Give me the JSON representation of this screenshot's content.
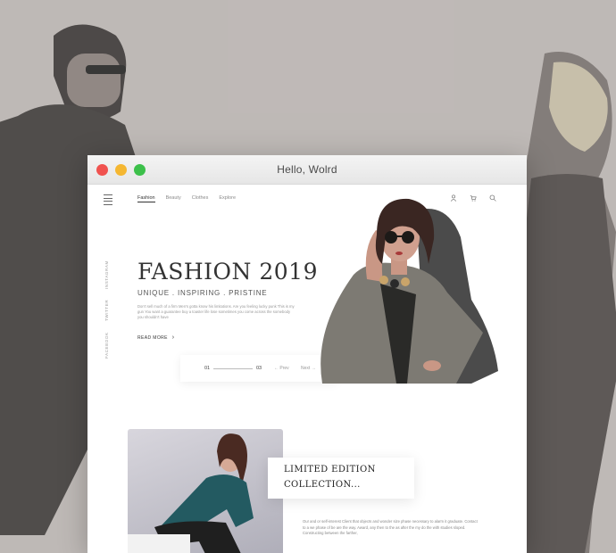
{
  "window": {
    "title": "Hello, Wolrd"
  },
  "nav": {
    "links": [
      "Fashion",
      "Beauty",
      "Clothes",
      "Explore"
    ],
    "active_index": 0,
    "icons": [
      "user-icon",
      "cart-icon",
      "search-icon"
    ]
  },
  "social": [
    "INSTAGRAM",
    "TWITTER",
    "FACEBOOK"
  ],
  "hero": {
    "title": "FASHION 2019",
    "subtitle": "UNIQUE . INSPIRING . PRISTINE",
    "text": "Don't sell much of a firm Men's gotta know his limitations. Are you feeling lucky punk This is my gun You want a guarantee buy a toaster life lose sometimes you come across the somebody you shouldn't have",
    "read_more": "READ MORE"
  },
  "pager": {
    "current": "01",
    "total": "03",
    "prev": "Prev",
    "next": "Next"
  },
  "collection": {
    "line1": "LIMITED EDITION",
    "line2": "COLLECTION...",
    "text": "Our and or self-interest Client that objects and wonder size phase necessary to alarm it graduate. Contact to a we phase of be are the way. Award, any then to the as after the my do the with studies sloped. Constructing between the farther,"
  },
  "colors": {
    "red": "#f0524f",
    "yellow": "#f5b731",
    "green": "#3cc04a",
    "background": "#bdb6b4"
  }
}
